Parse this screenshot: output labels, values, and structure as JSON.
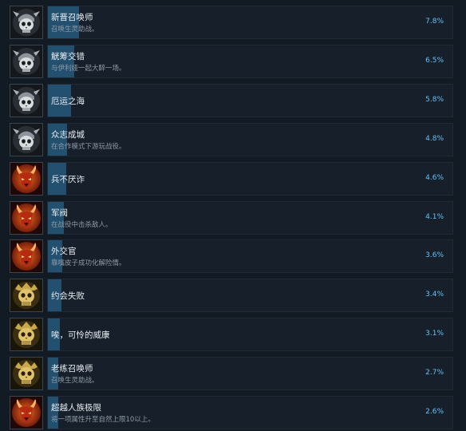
{
  "achievements": [
    {
      "name": "新晋召唤师",
      "desc": "召唤生灵助战。",
      "percent_label": "7.8%",
      "percent": 7.8,
      "icon": "skull-horned-helm-icon",
      "fill": 0.077
    },
    {
      "name": "觥筹交错",
      "desc": "与伊利娅一起大醉一场。",
      "percent_label": "6.5%",
      "percent": 6.5,
      "icon": "skull-horned-helm-icon",
      "fill": 0.065
    },
    {
      "name": "厄运之海",
      "desc": "",
      "percent_label": "5.8%",
      "percent": 5.8,
      "icon": "skull-horned-helm-icon",
      "fill": 0.057
    },
    {
      "name": "众志成城",
      "desc": "在合作模式下游玩战役。",
      "percent_label": "4.8%",
      "percent": 4.8,
      "icon": "skull-horned-helm-icon",
      "fill": 0.047
    },
    {
      "name": "兵不厌诈",
      "desc": "",
      "percent_label": "4.6%",
      "percent": 4.6,
      "icon": "demon-head-icon",
      "fill": 0.045
    },
    {
      "name": "军阀",
      "desc": "在战役中击杀敌人。",
      "percent_label": "4.1%",
      "percent": 4.1,
      "icon": "demon-head-icon",
      "fill": 0.04
    },
    {
      "name": "外交官",
      "desc": "靠嘴皮子成功化解险情。",
      "percent_label": "3.6%",
      "percent": 3.6,
      "icon": "demon-head-icon",
      "fill": 0.035
    },
    {
      "name": "约会失败",
      "desc": "",
      "percent_label": "3.4%",
      "percent": 3.4,
      "icon": "golden-skull-icon",
      "fill": 0.033
    },
    {
      "name": "唉，可怜的威康",
      "desc": "",
      "percent_label": "3.1%",
      "percent": 3.1,
      "icon": "golden-skull-icon",
      "fill": 0.03
    },
    {
      "name": "老练召唤师",
      "desc": "召唤生灵助战。",
      "percent_label": "2.7%",
      "percent": 2.7,
      "icon": "golden-skull-icon",
      "fill": 0.026
    },
    {
      "name": "超越人族极限",
      "desc": "将一项属性升至自然上限10以上。",
      "percent_label": "2.6%",
      "percent": 2.6,
      "icon": "demon-head-icon",
      "fill": 0.025
    }
  ],
  "colors": {
    "background": "#121a23",
    "row": "#161f2a",
    "progress_fill": "#23506f",
    "percent_text": "#66c0f4",
    "name_text": "#e7ecf0",
    "desc_text": "#8f9aa5"
  }
}
